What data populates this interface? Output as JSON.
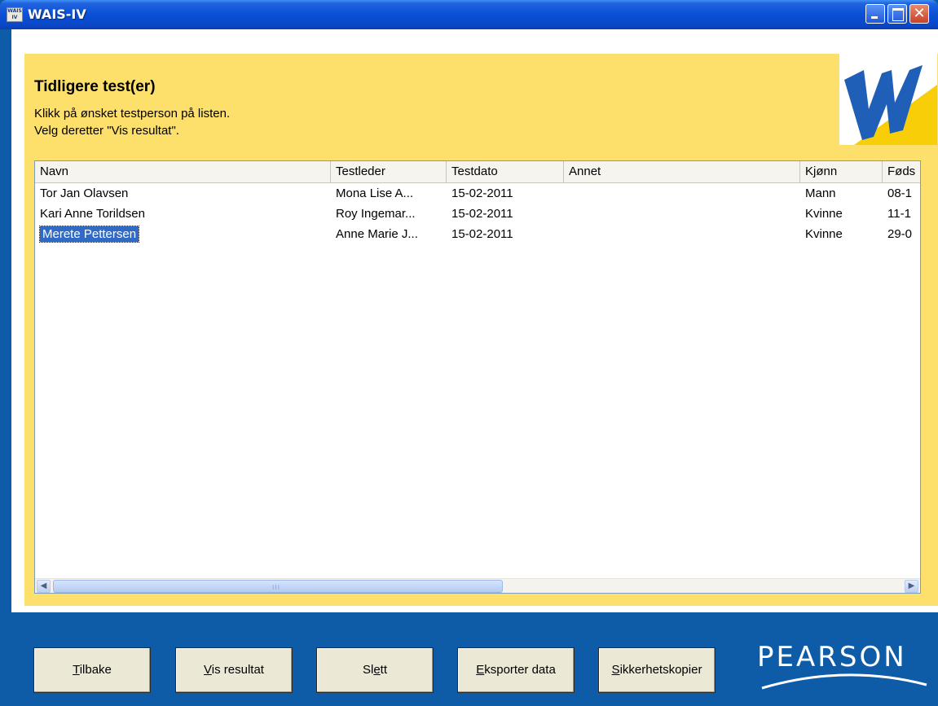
{
  "window": {
    "title": "WAIS-IV",
    "app_icon_text_1": "WAIS",
    "app_icon_text_2": "IV",
    "icons": [
      "minimize-icon",
      "maximize-icon",
      "close-icon"
    ]
  },
  "page": {
    "heading": "Tidligere test(er)",
    "instruction_1": "Klikk på ønsket testperson på listen.",
    "instruction_2": "Velg deretter \"Vis resultat\"."
  },
  "list": {
    "columns": [
      "Navn",
      "Testleder",
      "Testdato",
      "Annet",
      "Kjønn",
      "Føds"
    ],
    "rows": [
      {
        "navn": "Tor Jan Olavsen",
        "testleder": "Mona Lise A...",
        "testdato": "15-02-2011",
        "annet": "",
        "kjonn": "Mann",
        "fods": "08-1"
      },
      {
        "navn": "Kari Anne Torildsen",
        "testleder": "Roy Ingemar...",
        "testdato": "15-02-2011",
        "annet": "",
        "kjonn": "Kvinne",
        "fods": "11-1"
      },
      {
        "navn": "Merete Pettersen",
        "testleder": "Anne Marie J...",
        "testdato": "15-02-2011",
        "annet": "",
        "kjonn": "Kvinne",
        "fods": "29-0"
      }
    ],
    "selected_row": 2,
    "scrollbar_grip": "III"
  },
  "buttons": {
    "tilbake": {
      "mnemonic": "T",
      "rest": "ilbake"
    },
    "vis_resultat": {
      "mnemonic": "V",
      "rest": "is resultat"
    },
    "slett": {
      "pre": "Sl",
      "mnemonic": "e",
      "rest": "tt"
    },
    "eksporter": {
      "mnemonic": "E",
      "rest": "ksporter data"
    },
    "sikkerhet": {
      "mnemonic": "S",
      "rest": "ikkerhetskopier"
    }
  },
  "brand": {
    "name": "PEARSON",
    "accent_yellow": "#FDDF6B",
    "background_blue": "#0E5BA8",
    "selection_blue": "#316AC5"
  }
}
